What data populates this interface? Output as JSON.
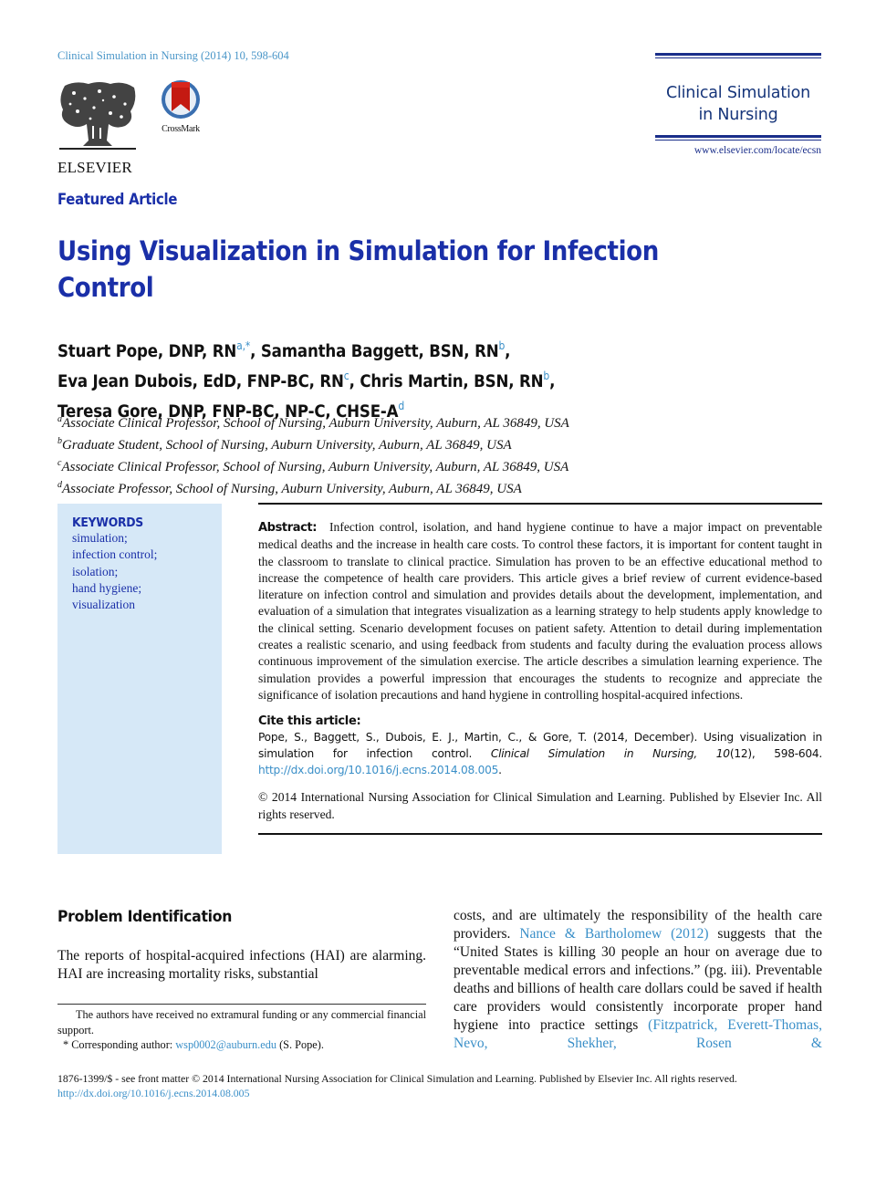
{
  "header": {
    "journal_ref": "Clinical Simulation in Nursing (2014) 10, 598-604",
    "publisher_logo_text": "ELSEVIER",
    "crossmark_label": "CrossMark",
    "masthead_title_line1": "Clinical Simulation",
    "masthead_title_line2": "in Nursing",
    "masthead_url": "www.elsevier.com/locate/ecsn"
  },
  "article": {
    "category": "Featured Article",
    "title": "Using Visualization in Simulation for Infection Control",
    "authors": [
      {
        "name": "Stuart Pope, DNP, RN",
        "sup": "a,*",
        "sep": ", "
      },
      {
        "name": "Samantha Baggett, BSN, RN",
        "sup": "b",
        "sep": ","
      },
      {
        "name": "Eva Jean Dubois, EdD, FNP-BC, RN",
        "sup": "c",
        "sep": ", "
      },
      {
        "name": "Chris Martin, BSN, RN",
        "sup": "b",
        "sep": ","
      },
      {
        "name": "Teresa Gore, DNP, FNP-BC, NP-C, CHSE-A",
        "sup": "d",
        "sep": ""
      }
    ],
    "affiliations": [
      {
        "mark": "a",
        "text": "Associate Clinical Professor, School of Nursing, Auburn University, Auburn, AL 36849, USA"
      },
      {
        "mark": "b",
        "text": "Graduate Student, School of Nursing, Auburn University, Auburn, AL 36849, USA"
      },
      {
        "mark": "c",
        "text": "Associate Clinical Professor, School of Nursing, Auburn University, Auburn, AL 36849, USA"
      },
      {
        "mark": "d",
        "text": "Associate Professor, School of Nursing, Auburn University, Auburn, AL 36849, USA"
      }
    ]
  },
  "keywords": {
    "heading": "KEYWORDS",
    "items": [
      "simulation;",
      "infection control;",
      "isolation;",
      "hand hygiene;",
      "visualization"
    ]
  },
  "abstract": {
    "label": "Abstract:",
    "text": "Infection control, isolation, and hand hygiene continue to have a major impact on preventable medical deaths and the increase in health care costs. To control these factors, it is important for content taught in the classroom to translate to clinical practice. Simulation has proven to be an effective educational method to increase the competence of health care providers. This article gives a brief review of current evidence-based literature on infection control and simulation and provides details about the development, implementation, and evaluation of a simulation that integrates visualization as a learning strategy to help students apply knowledge to the clinical setting. Scenario development focuses on patient safety. Attention to detail during implementation creates a realistic scenario, and using feedback from students and faculty during the evaluation process allows continuous improvement of the simulation exercise. The article describes a simulation learning experience. The simulation provides a powerful impression that encourages the students to recognize and appreciate the significance of isolation precautions and hand hygiene in controlling hospital-acquired infections."
  },
  "citation": {
    "heading": "Cite this article:",
    "text_before": "Pope, S., Baggett, S., Dubois, E. J., Martin, C., & Gore, T. (2014, December). Using visualization in simulation for infection control. ",
    "journal_italic": "Clinical Simulation in Nursing, 10",
    "text_after": "(12), 598-604. ",
    "doi_link": "http://dx.doi.org/10.1016/j.ecns.2014.08.005",
    "end": "."
  },
  "copyright": "© 2014 International Nursing Association for Clinical Simulation and Learning. Published by Elsevier Inc. All rights reserved.",
  "body": {
    "section_heading": "Problem Identification",
    "left_paragraph": "The reports of hospital-acquired infections (HAI) are alarming. HAI are increasing mortality risks, substantial",
    "right_before_link": "costs, and are ultimately the responsibility of the health care providers. ",
    "right_link1": "Nance & Bartholomew (2012)",
    "right_middle": " suggests that the “United States is killing 30 people an hour on average due to preventable medical errors and infections.” (pg. iii). Preventable deaths and billions of health care dollars could be saved if health care providers would consistently incorporate proper hand hygiene into practice settings ",
    "right_link2": "(Fitzpatrick, Everett-Thomas, Nevo, Shekher, Rosen &"
  },
  "footnotes": {
    "funding": "The authors have received no extramural funding or any commercial financial support.",
    "corresponding_prefix": "* Corresponding author: ",
    "email": "wsp0002@auburn.edu",
    "corresponding_suffix": " (S. Pope)."
  },
  "page_footer": {
    "issn_line": "1876-1399/$ - see front matter © 2014 International Nursing Association for Clinical Simulation and Learning. Published by Elsevier Inc. All rights reserved.",
    "doi": "http://dx.doi.org/10.1016/j.ecns.2014.08.005"
  }
}
